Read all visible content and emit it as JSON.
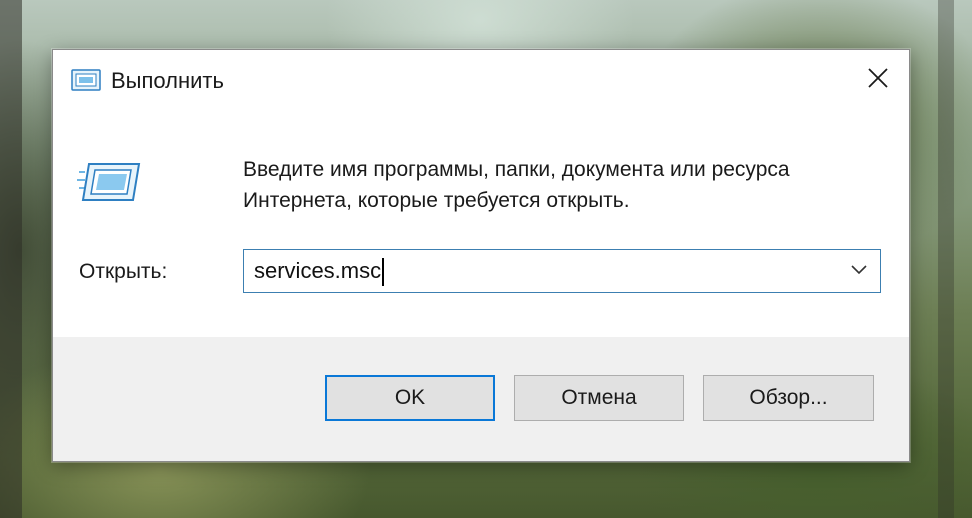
{
  "window": {
    "title": "Выполнить",
    "close_glyph": "✕"
  },
  "prompt": {
    "line1": "Введите имя программы, папки, документа или ресурса",
    "line2": "Интернета, которые требуется открыть."
  },
  "open_field": {
    "label": "Открыть:",
    "value": "services.msc"
  },
  "buttons": {
    "ok": "OK",
    "cancel": "Отмена",
    "browse": "Обзор..."
  },
  "icons": {
    "title": "run-icon",
    "large": "run-large-icon",
    "close": "close-icon",
    "dropdown": "chevron-down-icon"
  },
  "colors": {
    "accent": "#0a78d7",
    "field_border": "#3c7fb1",
    "button_face": "#e1e1e1",
    "footer_bg": "#f0f0f0"
  }
}
